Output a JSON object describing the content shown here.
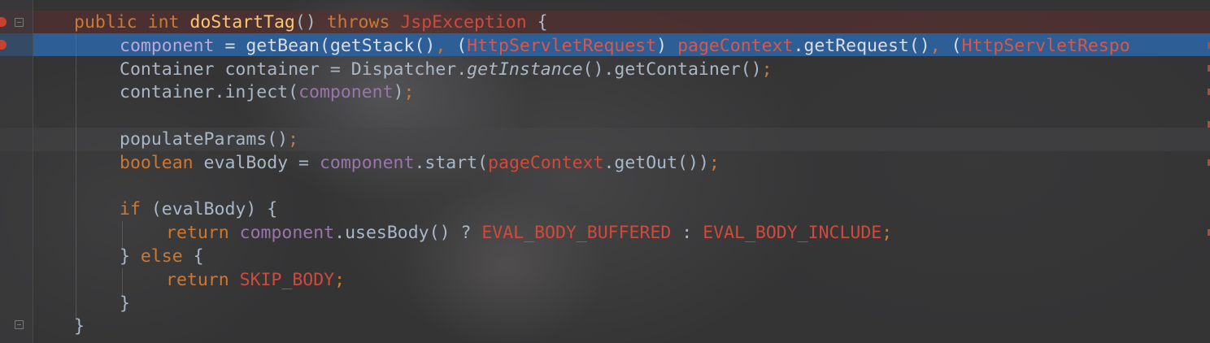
{
  "editor": {
    "theme_colors": {
      "keyword": "#cc7832",
      "function": "#ffc66d",
      "field": "#9876aa",
      "type": "#d04a3c",
      "plain": "#a9b7c6",
      "selection": "#2e5e96"
    },
    "lines": [
      {
        "tokens": [
          {
            "t": "public",
            "c": "kw"
          },
          {
            "t": " ",
            "c": "pl"
          },
          {
            "t": "int",
            "c": "kw"
          },
          {
            "t": " ",
            "c": "pl"
          },
          {
            "t": "doStartTag",
            "c": "fn"
          },
          {
            "t": "() ",
            "c": "pl"
          },
          {
            "t": "throws",
            "c": "kw"
          },
          {
            "t": " ",
            "c": "pl"
          },
          {
            "t": "JspException",
            "c": "ty"
          },
          {
            "t": " {",
            "c": "pl"
          }
        ]
      },
      {
        "tokens": [
          {
            "t": "component",
            "c": "fld"
          },
          {
            "t": " = getBean(getStack()",
            "c": "pl"
          },
          {
            "t": ", ",
            "c": "kw"
          },
          {
            "t": "(",
            "c": "pl"
          },
          {
            "t": "HttpServletRequest",
            "c": "ty"
          },
          {
            "t": ") ",
            "c": "pl"
          },
          {
            "t": "pageContext",
            "c": "ty"
          },
          {
            "t": ".getRequest()",
            "c": "pl"
          },
          {
            "t": ", ",
            "c": "kw"
          },
          {
            "t": "(",
            "c": "pl"
          },
          {
            "t": "HttpServletRespo",
            "c": "ty"
          }
        ]
      },
      {
        "tokens": [
          {
            "t": "Container container = Dispatcher.",
            "c": "pl"
          },
          {
            "t": "getInstance",
            "c": "pl it"
          },
          {
            "t": "().getContainer()",
            "c": "pl"
          },
          {
            "t": ";",
            "c": "kw"
          }
        ]
      },
      {
        "tokens": [
          {
            "t": "container.inject(",
            "c": "pl"
          },
          {
            "t": "component",
            "c": "fld"
          },
          {
            "t": ")",
            "c": "pl"
          },
          {
            "t": ";",
            "c": "kw"
          }
        ]
      },
      {
        "tokens": []
      },
      {
        "tokens": [
          {
            "t": "populateParams()",
            "c": "pl"
          },
          {
            "t": ";",
            "c": "kw"
          }
        ]
      },
      {
        "tokens": [
          {
            "t": "boolean",
            "c": "kw"
          },
          {
            "t": " evalBody = ",
            "c": "pl"
          },
          {
            "t": "component",
            "c": "fld"
          },
          {
            "t": ".start(",
            "c": "pl"
          },
          {
            "t": "pageContext",
            "c": "ty"
          },
          {
            "t": ".getOut())",
            "c": "pl"
          },
          {
            "t": ";",
            "c": "kw"
          }
        ]
      },
      {
        "tokens": []
      },
      {
        "tokens": [
          {
            "t": "if",
            "c": "kw"
          },
          {
            "t": " (evalBody) {",
            "c": "pl"
          }
        ]
      },
      {
        "tokens": [
          {
            "t": "return",
            "c": "kw"
          },
          {
            "t": " ",
            "c": "pl"
          },
          {
            "t": "component",
            "c": "fld"
          },
          {
            "t": ".usesBody() ? ",
            "c": "pl"
          },
          {
            "t": "EVAL_BODY_BUFFERED",
            "c": "cst"
          },
          {
            "t": " : ",
            "c": "pl"
          },
          {
            "t": "EVAL_BODY_INCLUDE",
            "c": "cst"
          },
          {
            "t": ";",
            "c": "kw"
          }
        ]
      },
      {
        "tokens": [
          {
            "t": "} ",
            "c": "pl"
          },
          {
            "t": "else",
            "c": "kw"
          },
          {
            "t": " {",
            "c": "pl"
          }
        ]
      },
      {
        "tokens": [
          {
            "t": "return",
            "c": "kw"
          },
          {
            "t": " ",
            "c": "pl"
          },
          {
            "t": "SKIP_BODY",
            "c": "cst"
          },
          {
            "t": ";",
            "c": "kw"
          }
        ]
      },
      {
        "tokens": [
          {
            "t": "}",
            "c": "pl"
          }
        ]
      },
      {
        "tokens": [
          {
            "t": "}",
            "c": "pl"
          }
        ]
      }
    ]
  }
}
